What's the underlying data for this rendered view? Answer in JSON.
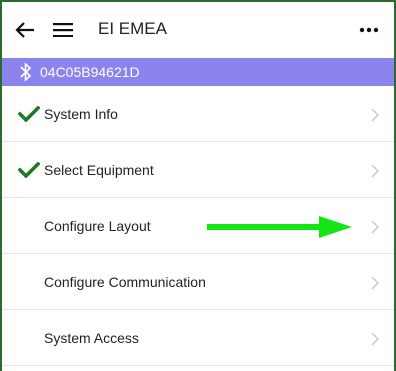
{
  "header": {
    "title": "EI EMEA",
    "back_icon": "back-arrow-icon",
    "menu_icon": "hamburger-menu-icon",
    "more_icon": "more-options-icon"
  },
  "device": {
    "icon": "bluetooth-icon",
    "id": "04C05B94621D",
    "bar_color": "#8b84ec"
  },
  "menu": {
    "items": [
      {
        "label": "System Info",
        "completed": true
      },
      {
        "label": "Select Equipment",
        "completed": true
      },
      {
        "label": "Configure Layout",
        "completed": false,
        "highlighted": true
      },
      {
        "label": "Configure Communication",
        "completed": false
      },
      {
        "label": "System Access",
        "completed": false
      }
    ],
    "check_color": "#1e7a2a",
    "arrow_color": "#14e614",
    "chevron_icon": "chevron-right-icon"
  }
}
